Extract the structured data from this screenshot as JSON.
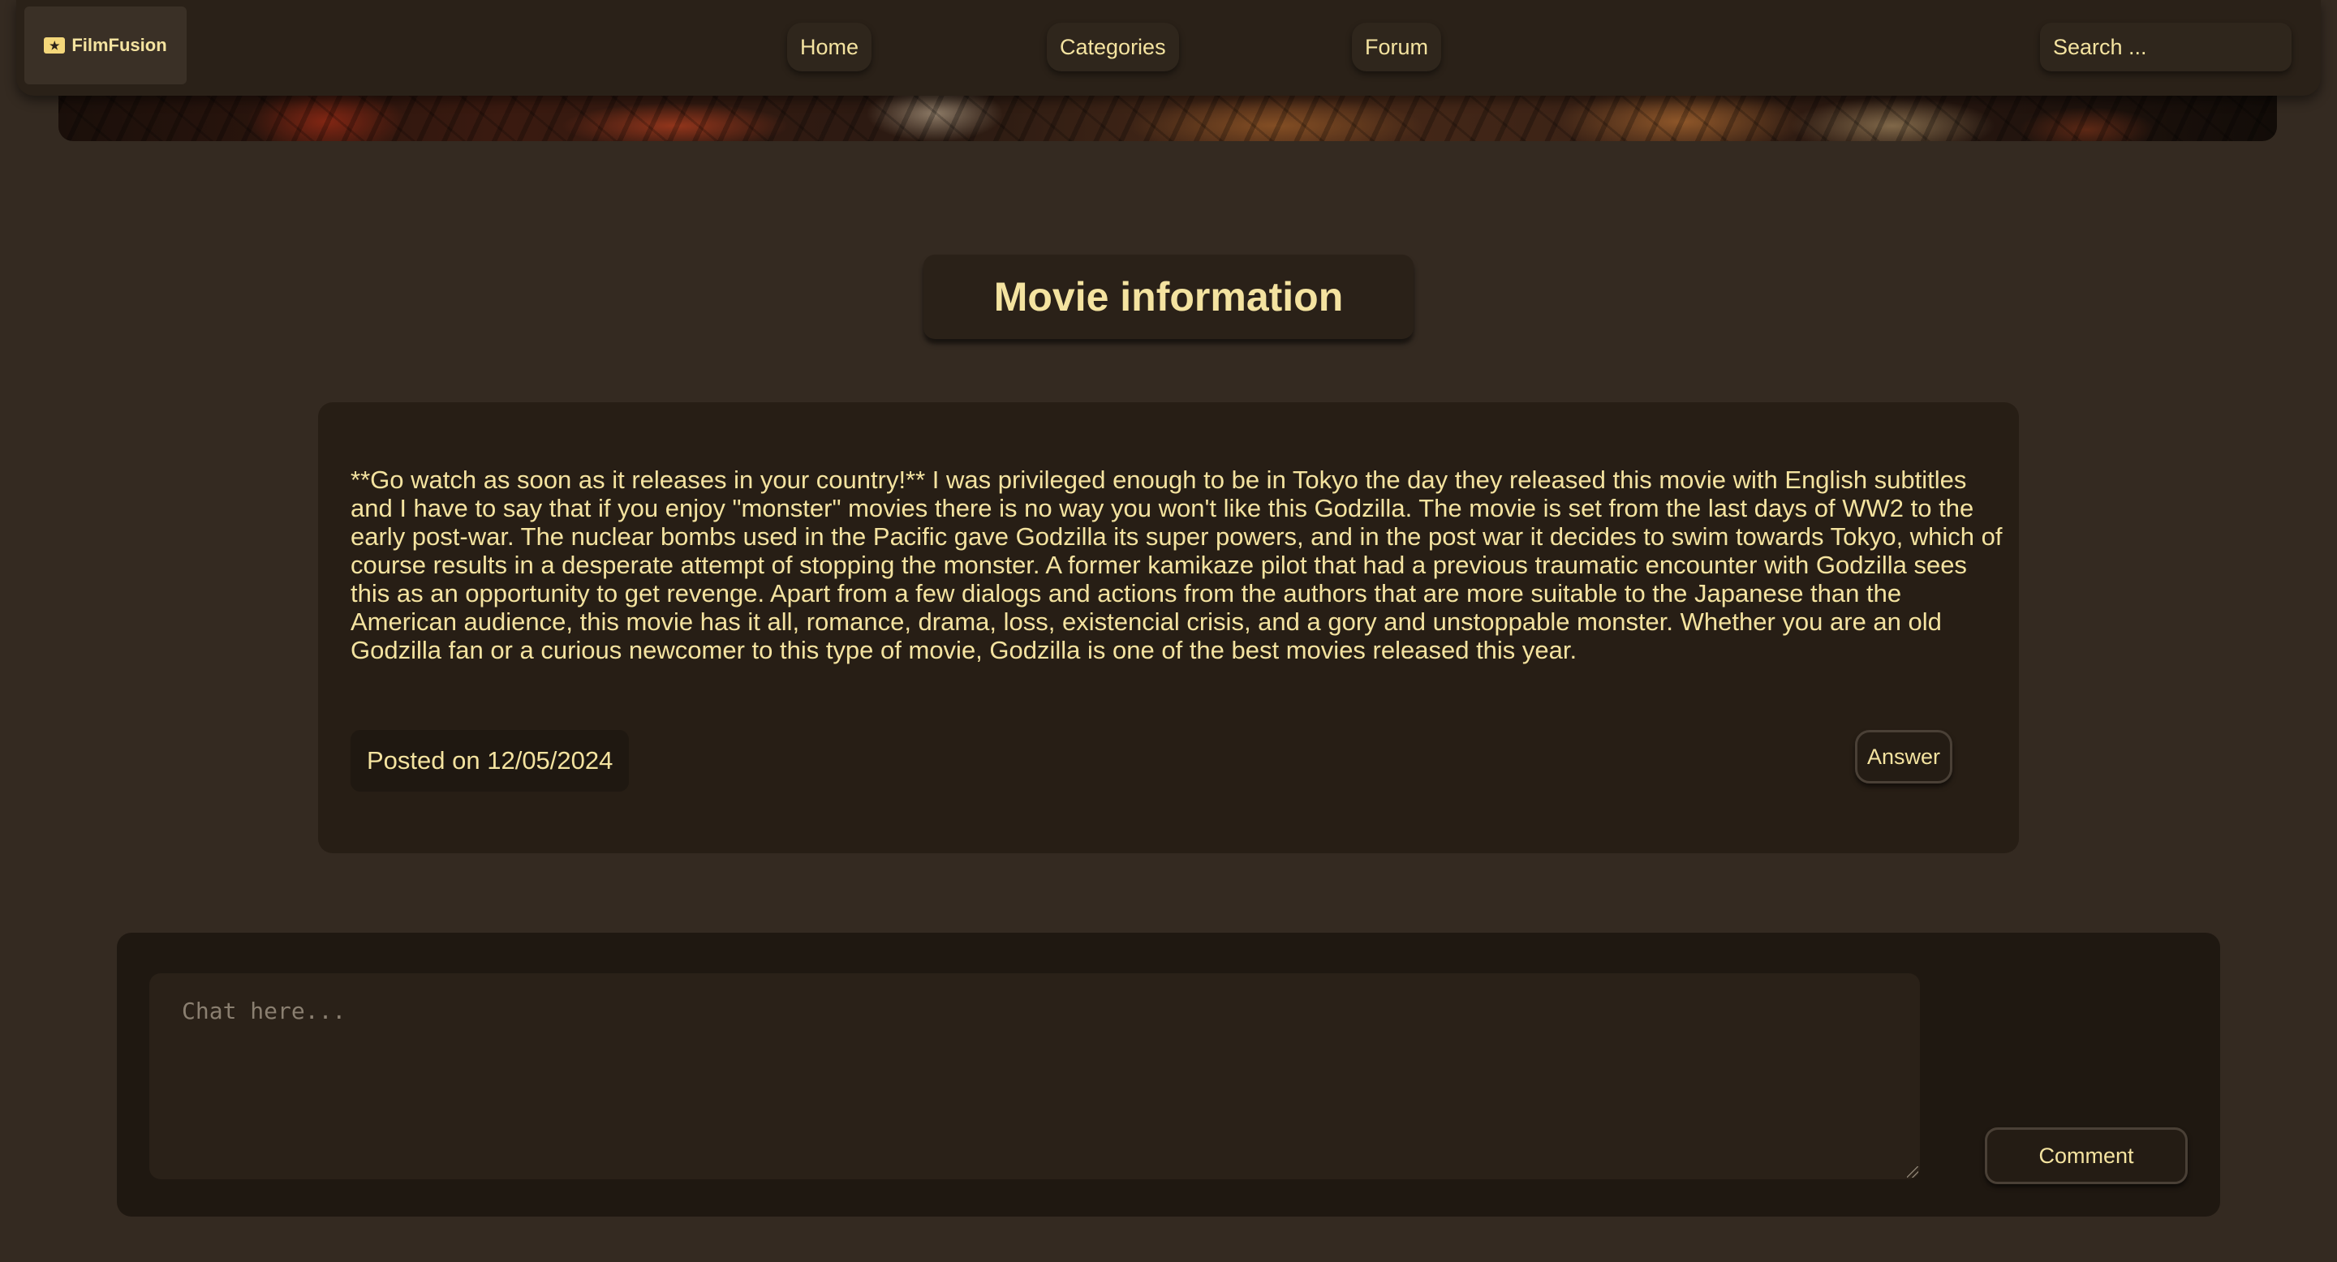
{
  "navbar": {
    "logo_text": "FilmFusion",
    "logo_icon": "ticket-icon",
    "items": [
      {
        "label": "Home"
      },
      {
        "label": "Categories"
      },
      {
        "label": "Forum"
      }
    ],
    "search_placeholder": "Search ..."
  },
  "main": {
    "title": "Movie information",
    "review": {
      "text": "**Go watch as soon as it releases in your country!** I was privileged enough to be in Tokyo the day they released this movie with English subtitles and I have to say that if you enjoy \"monster\" movies there is no way you won't like this Godzilla. The movie is set from the last days of WW2 to the early post-war. The nuclear bombs used in the Pacific gave Godzilla its super powers, and in the post war it decides to swim towards Tokyo, which of course results in a desperate attempt of stopping the monster. A former kamikaze pilot that had a previous traumatic encounter with Godzilla sees this as an opportunity to get revenge. Apart from a few dialogs and actions from the authors that are more suitable to the Japanese than the American audience, this movie has it all, romance, drama, loss, existencial crisis, and a gory and unstoppable monster. Whether you are an old Godzilla fan or a curious newcomer to this type of movie, Godzilla is one of the best movies released this year.",
      "posted_label": "Posted on 12/05/2024",
      "answer_label": "Answer"
    }
  },
  "comment": {
    "placeholder": "Chat here...",
    "value": "",
    "button_label": "Comment"
  },
  "colors": {
    "background": "#342a21",
    "panel": "#2a2118",
    "text": "#f4e3a0"
  }
}
